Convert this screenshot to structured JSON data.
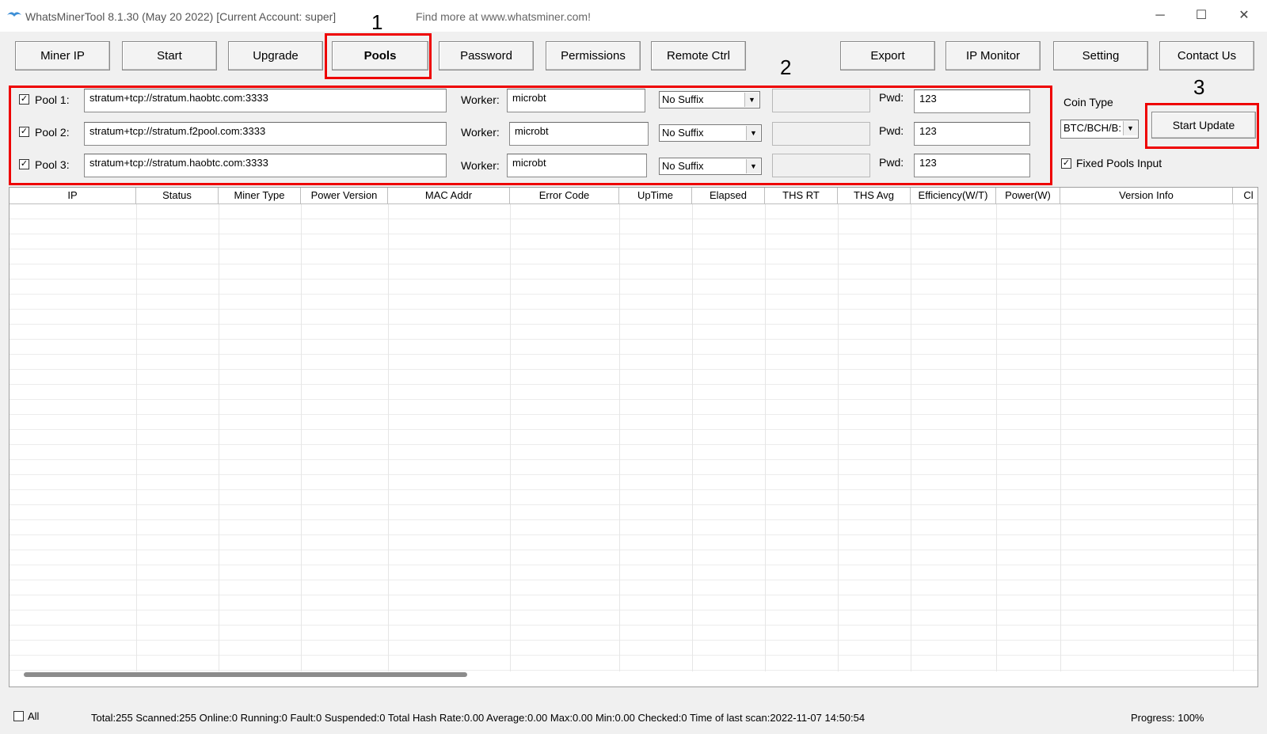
{
  "window": {
    "title": "WhatsMinerTool 8.1.30 (May 20 2022) [Current Account: super]",
    "link_text": "Find more at www.whatsminer.com!",
    "minimize_glyph": "─",
    "maximize_glyph": "☐",
    "close_glyph": "✕"
  },
  "toolbar": {
    "miner_ip": "Miner IP",
    "start": "Start",
    "upgrade": "Upgrade",
    "pools": "Pools",
    "password": "Password",
    "permissions": "Permissions",
    "remote_ctrl": "Remote Ctrl",
    "export": "Export",
    "ip_monitor": "IP Monitor",
    "setting": "Setting",
    "contact_us": "Contact Us"
  },
  "annotations": [
    "1",
    "2",
    "3"
  ],
  "pools": [
    {
      "label": "Pool 1:",
      "checked": "✓",
      "url": "stratum+tcp://stratum.haobtc.com:3333",
      "worker_label": "Worker:",
      "worker": "microbt",
      "suffix": "No Suffix",
      "pwd_label": "Pwd:",
      "pwd": "123"
    },
    {
      "label": "Pool 2:",
      "checked": "✓",
      "url": "stratum+tcp://stratum.f2pool.com:3333",
      "worker_label": "Worker:",
      "worker": "microbt",
      "suffix": "No Suffix",
      "pwd_label": "Pwd:",
      "pwd": "123"
    },
    {
      "label": "Pool 3:",
      "checked": "✓",
      "url": "stratum+tcp://stratum.haobtc.com:3333",
      "worker_label": "Worker:",
      "worker": "microbt",
      "suffix": "No Suffix",
      "pwd_label": "Pwd:",
      "pwd": "123"
    }
  ],
  "side_panel": {
    "coin_type_label": "Coin Type",
    "coin_type_value": "BTC/BCH/B:",
    "start_update": "Start Update",
    "fixed_pools_checked": "✓",
    "fixed_pools_label": "Fixed Pools Input"
  },
  "table": {
    "columns": [
      "IP",
      "Status",
      "Miner Type",
      "Power Version",
      "MAC Addr",
      "Error Code",
      "UpTime",
      "Elapsed",
      "THS RT",
      "THS Avg",
      "Efficiency(W/T)",
      "Power(W)",
      "Version Info",
      "Cl"
    ]
  },
  "statusbar": {
    "all_label": "All",
    "summary": "Total:255  Scanned:255  Online:0  Running:0  Fault:0  Suspended:0  Total Hash Rate:0.00  Average:0.00  Max:0.00  Min:0.00  Checked:0  Time of last scan:2022-11-07 14:50:54",
    "progress": "Progress: 100%"
  },
  "colors": {
    "annotation_box": "#e00000",
    "window_bg": "#f0f0f0"
  }
}
